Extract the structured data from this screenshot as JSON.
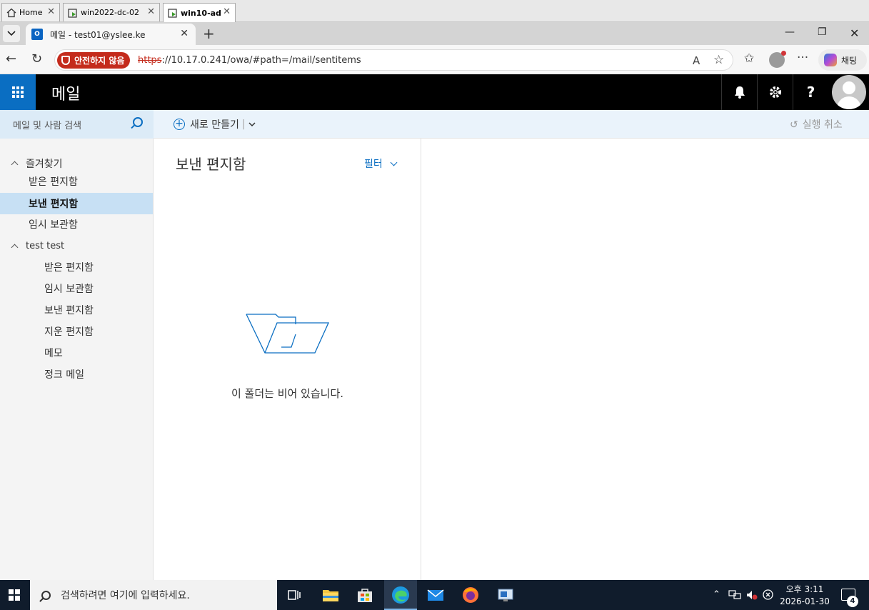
{
  "vm_tabs": [
    {
      "label": "Home",
      "icon": "home-icon"
    },
    {
      "label": "win2022-dc-02",
      "icon": "vm-console-icon"
    },
    {
      "label": "win10-ad",
      "icon": "vm-console-icon"
    }
  ],
  "browser": {
    "tab_title": "메일 - test01@yslee.ke",
    "security_badge": "안전하지 않음",
    "url_scheme": "https",
    "url_rest": "://10.17.0.241/owa/#path=/mail/sentitems",
    "copilot_label": "채팅"
  },
  "owa": {
    "app_title": "메일",
    "search_placeholder": "메일 및 사람 검색",
    "new_button": "새로 만들기",
    "undo_button": "실행 취소",
    "favorites_header": "즐겨찾기",
    "favorites": [
      "받은 편지함",
      "보낸 편지함",
      "임시 보관함"
    ],
    "account_header": "test test",
    "account_folders": [
      "받은 편지함",
      "임시 보관함",
      "보낸 편지함",
      "지운 편지함",
      "메모",
      "정크 메일"
    ],
    "folder_title": "보낸 편지함",
    "filter_label": "필터",
    "empty_message": "이 폴더는 비어 있습니다."
  },
  "taskbar": {
    "search_placeholder": "검색하려면 여기에 입력하세요.",
    "time": "오후 3:11",
    "date": "2026-01-30",
    "notification_count": "4"
  },
  "colors": {
    "accent": "#0a6ec2",
    "selected_nav": "#c7e0f4",
    "unsafe_badge": "#c42b1c",
    "taskbar": "#101c2c"
  }
}
